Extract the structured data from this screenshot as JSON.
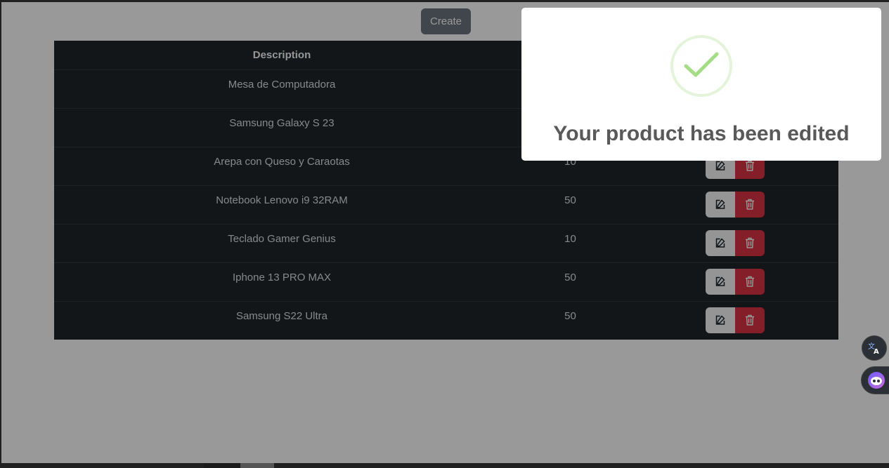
{
  "toolbar": {
    "create_label": "Create"
  },
  "table": {
    "headers": {
      "description": "Description"
    },
    "rows": [
      {
        "description": "Mesa de Computadora",
        "quantity": ""
      },
      {
        "description": "Samsung Galaxy S 23",
        "quantity": ""
      },
      {
        "description": "Arepa con Queso y Caraotas",
        "quantity": "10"
      },
      {
        "description": "Notebook Lenovo i9 32RAM",
        "quantity": "50"
      },
      {
        "description": "Teclado Gamer Genius",
        "quantity": "10"
      },
      {
        "description": "Iphone 13 PRO MAX",
        "quantity": "50"
      },
      {
        "description": "Samsung S22 Ultra",
        "quantity": "50"
      }
    ]
  },
  "popup": {
    "title": "Your product has been edited"
  },
  "colors": {
    "table_bg": "#212529",
    "edit_button": "#f8f9fa",
    "delete_button": "#dc3545",
    "success_check": "#a5dc86",
    "create_button": "#6c757d"
  },
  "icons": {
    "edit": "pencil-square-icon",
    "delete": "trash-icon",
    "success": "checkmark-icon",
    "translate": "translate-icon",
    "assistant": "assistant-icon"
  }
}
